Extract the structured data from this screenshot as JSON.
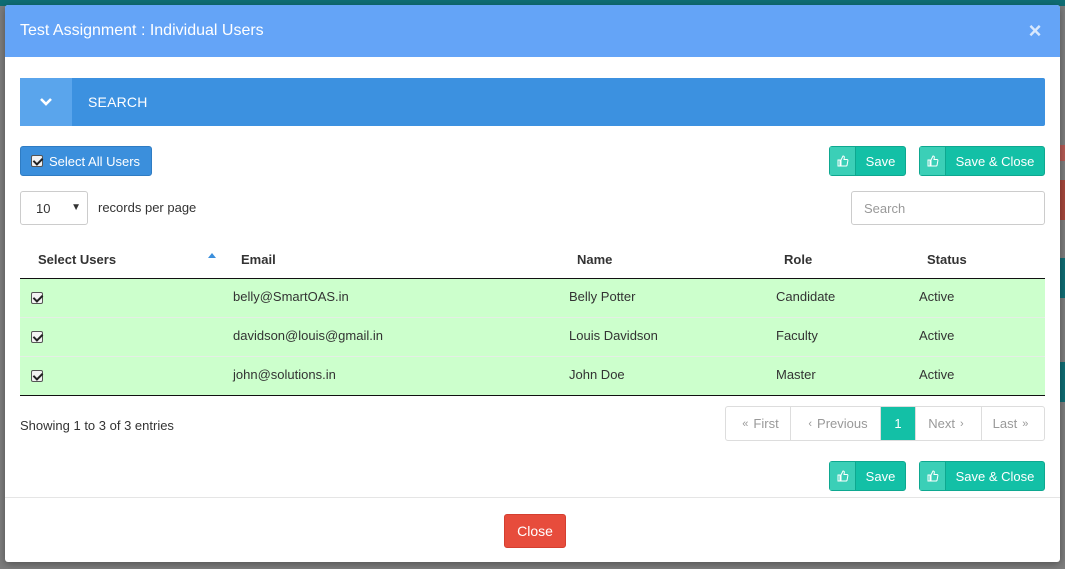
{
  "modal": {
    "title": "Test Assignment : Individual Users",
    "close_x": "×"
  },
  "search_panel": {
    "label": "SEARCH",
    "toggle_icon": "chevron-down-icon"
  },
  "toolbar": {
    "select_all_label": "Select All Users",
    "save_label": "Save",
    "save_close_label": "Save & Close",
    "save_icon": "thumbs-up-icon"
  },
  "controls": {
    "page_size": "10",
    "records_label": "records per page",
    "search_placeholder": "Search"
  },
  "table": {
    "columns": [
      "Select Users",
      "Email",
      "Name",
      "Role",
      "Status"
    ],
    "sorted_column": "Select Users",
    "rows": [
      {
        "selected": true,
        "email": "belly@SmartOAS.in",
        "name": "Belly Potter",
        "role": "Candidate",
        "status": "Active"
      },
      {
        "selected": true,
        "email": "davidson@louis@gmail.in",
        "name": "Louis Davidson",
        "role": "Faculty",
        "status": "Active"
      },
      {
        "selected": true,
        "email": "john@solutions.in",
        "name": "John Doe",
        "role": "Master",
        "status": "Active"
      }
    ],
    "row_color": "#ccffcc"
  },
  "pagination": {
    "info": "Showing 1 to 3 of 3 entries",
    "first": "First",
    "previous": "Previous",
    "current": "1",
    "next": "Next",
    "last": "Last"
  },
  "footer": {
    "close_label": "Close"
  },
  "colors": {
    "header": "#64a4f7",
    "search_bar": "#3c91e0",
    "primary": "#3b8fdc",
    "success": "#13c0a6",
    "danger": "#e74c3c"
  }
}
